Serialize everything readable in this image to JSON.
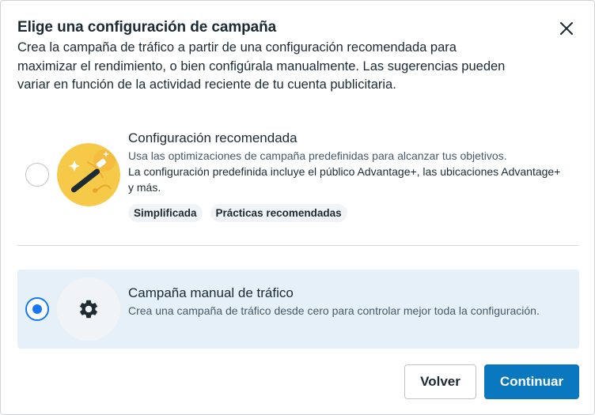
{
  "dialog": {
    "title": "Elige una configuración de campaña",
    "description": "Crea la campaña de tráfico a partir de una configuración recomendada para maximizar el rendimiento, o bien configúrala manualmente. Las sugerencias pueden variar en función de la actividad reciente de tu cuenta publicitaria.",
    "close_icon": "close-icon"
  },
  "options": {
    "recommended": {
      "title": "Configuración recomendada",
      "description_1": "Usa las optimizaciones de campaña predefinidas para alcanzar tus objetivos.",
      "description_2": "La configuración predefinida incluye el público Advantage+, las ubicaciones Advantage+ y más.",
      "selected": false,
      "icon": "magic-wand-icon",
      "tags": [
        "Simplificada",
        "Prácticas recomendadas"
      ]
    },
    "manual": {
      "title": "Campaña manual de tráfico",
      "description": "Crea una campaña de tráfico desde cero para controlar mejor toda la configuración.",
      "selected": true,
      "icon": "gear-icon"
    }
  },
  "footer": {
    "back_label": "Volver",
    "continue_label": "Continuar"
  },
  "colors": {
    "primary": "#0a78be",
    "radio_selected": "#1877f2",
    "selected_bg": "#e6f0f8"
  }
}
